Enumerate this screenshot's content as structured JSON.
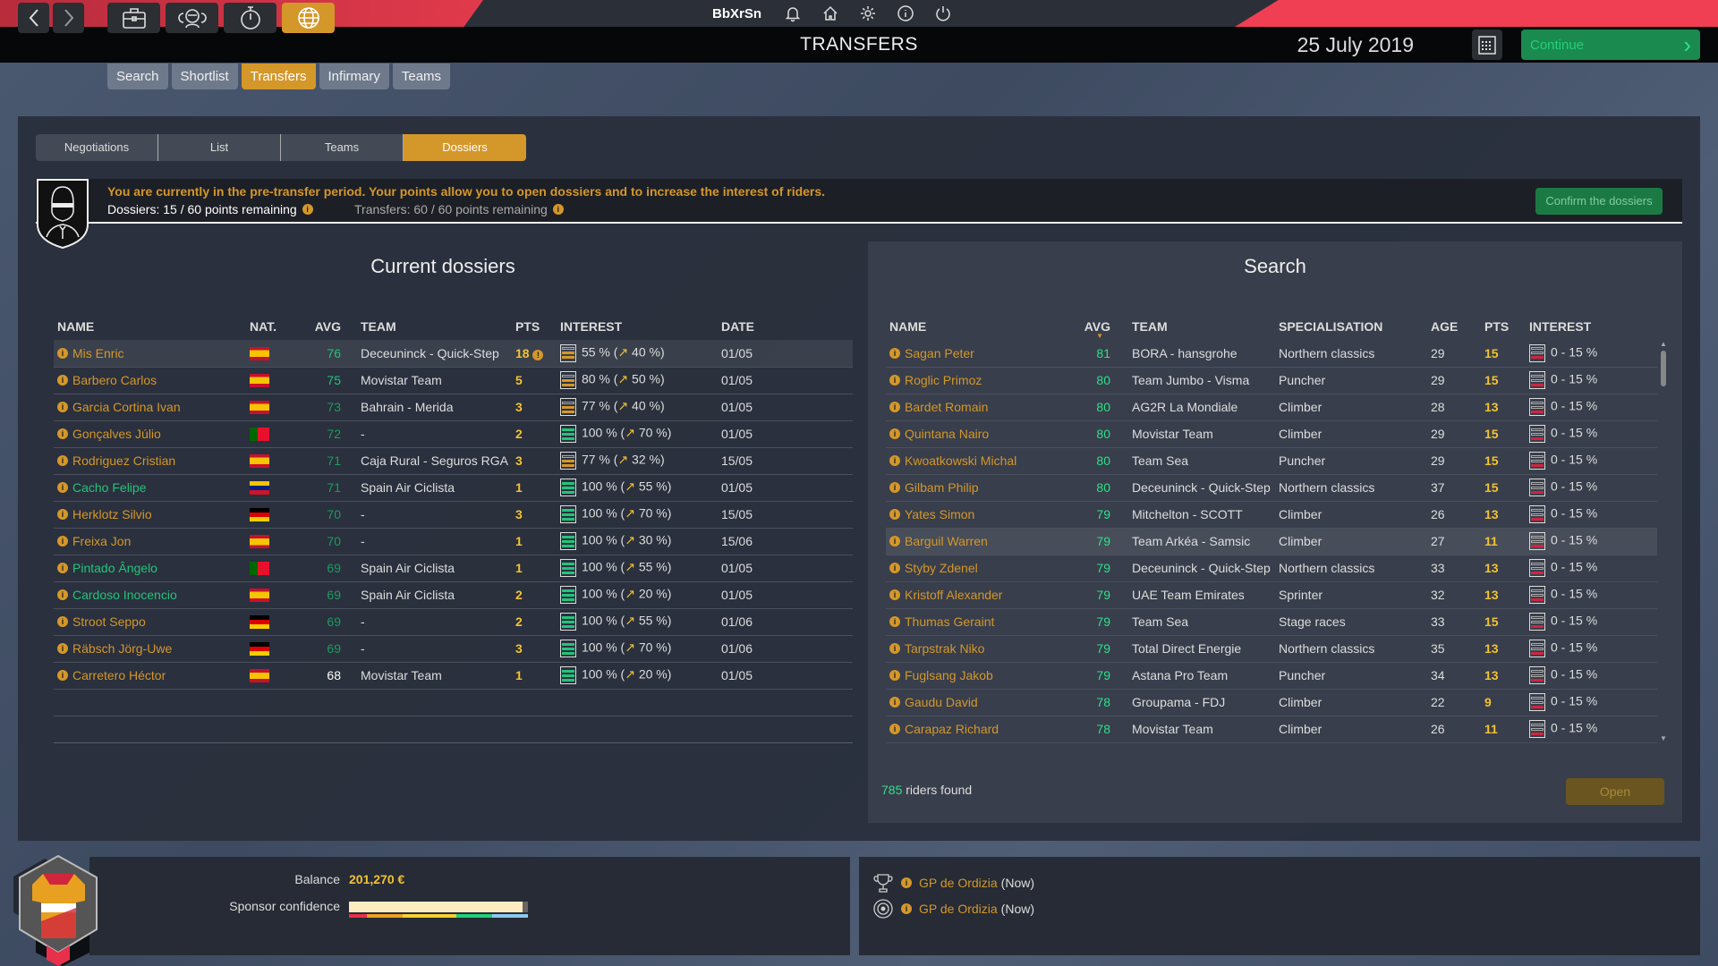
{
  "topbar": {
    "username": "BbXrSn",
    "icons": [
      "bell-icon",
      "home-icon",
      "gear-icon",
      "info-icon",
      "power-icon"
    ]
  },
  "nav": {
    "back_icon": "chevron-left-icon",
    "forward_icon": "chevron-right-icon",
    "sections": [
      {
        "icon": "briefcase-icon",
        "active": false
      },
      {
        "icon": "riders-icon",
        "active": false
      },
      {
        "icon": "stopwatch-icon",
        "active": false
      },
      {
        "icon": "globe-icon",
        "active": true
      }
    ],
    "page_title": "TRANSFERS",
    "date": "25 July 2019",
    "continue_label": "Continue"
  },
  "subtabs": [
    {
      "label": "Search",
      "active": false
    },
    {
      "label": "Shortlist",
      "active": false
    },
    {
      "label": "Transfers",
      "active": true
    },
    {
      "label": "Infirmary",
      "active": false
    },
    {
      "label": "Teams",
      "active": false
    }
  ],
  "tabs": [
    {
      "label": "Negotiations",
      "active": false
    },
    {
      "label": "List",
      "active": false
    },
    {
      "label": "Teams",
      "active": false
    },
    {
      "label": "Dossiers",
      "active": true
    }
  ],
  "info": {
    "message": "You are currently in the pre-transfer period. Your points allow you to open dossiers and to increase the interest of riders.",
    "dossiers_points": "Dossiers: 15 / 60 points remaining",
    "transfers_points": "Transfers: 60 / 60 points remaining",
    "confirm_label": "Confirm the dossiers"
  },
  "current_dossiers": {
    "title": "Current dossiers",
    "columns": [
      "NAME",
      "NAT.",
      "AVG",
      "TEAM",
      "PTS",
      "INTEREST",
      "DATE"
    ],
    "rows": [
      {
        "name": "Mis Enric",
        "nat": "es",
        "avg": "76",
        "avg_style": "g",
        "team": "Deceuninck - Quick-Step",
        "pts": "18",
        "pts_warn": true,
        "gauge": "o",
        "interest": "55 % (",
        "increase": "40 %)",
        "date": "01/05",
        "name_color": "orange",
        "highlight": true
      },
      {
        "name": "Barbero Carlos",
        "nat": "es",
        "avg": "75",
        "avg_style": "g",
        "team": "Movistar Team",
        "pts": "5",
        "gauge": "o",
        "interest": "80 % (",
        "increase": "50 %)",
        "date": "01/05",
        "name_color": "orange"
      },
      {
        "name": "Garcia Cortina Ivan",
        "nat": "es",
        "avg": "73",
        "avg_style": "dg",
        "team": "Bahrain - Merida",
        "pts": "3",
        "gauge": "o",
        "interest": "77 % (",
        "increase": "40 %)",
        "date": "01/05",
        "name_color": "orange"
      },
      {
        "name": "Gonçalves Júlio",
        "nat": "pt",
        "avg": "72",
        "avg_style": "dg",
        "team": "-",
        "pts": "2",
        "gauge": "g",
        "interest": "100 % (",
        "increase": "70 %)",
        "date": "01/05",
        "name_color": "orange"
      },
      {
        "name": "Rodriguez Cristian",
        "nat": "es",
        "avg": "71",
        "avg_style": "dg",
        "team": "Caja Rural - Seguros RGA",
        "pts": "3",
        "gauge": "o",
        "interest": "77 % (",
        "increase": "32 %)",
        "date": "15/05",
        "name_color": "orange"
      },
      {
        "name": "Cacho Felipe",
        "nat": "ve",
        "avg": "71",
        "avg_style": "dg",
        "team": "Spain Air Ciclista",
        "pts": "1",
        "gauge": "g",
        "interest": "100 % (",
        "increase": "55 %)",
        "date": "01/05",
        "name_color": "green"
      },
      {
        "name": "Herklotz Silvio",
        "nat": "de",
        "avg": "70",
        "avg_style": "dg",
        "team": "-",
        "pts": "3",
        "gauge": "g",
        "interest": "100 % (",
        "increase": "70 %)",
        "date": "15/05",
        "name_color": "orange"
      },
      {
        "name": "Freixa Jon",
        "nat": "es",
        "avg": "70",
        "avg_style": "dg",
        "team": "-",
        "pts": "1",
        "gauge": "g",
        "interest": "100 % (",
        "increase": "30 %)",
        "date": "15/06",
        "name_color": "orange"
      },
      {
        "name": "Pintado Ângelo",
        "nat": "pt",
        "avg": "69",
        "avg_style": "dg",
        "team": "Spain Air Ciclista",
        "pts": "1",
        "gauge": "g",
        "interest": "100 % (",
        "increase": "55 %)",
        "date": "01/05",
        "name_color": "green"
      },
      {
        "name": "Cardoso Inocencio",
        "nat": "es",
        "avg": "69",
        "avg_style": "dg",
        "team": "Spain Air Ciclista",
        "pts": "2",
        "gauge": "g",
        "interest": "100 % (",
        "increase": "20 %)",
        "date": "01/05",
        "name_color": "green"
      },
      {
        "name": "Stroot Seppo",
        "nat": "de",
        "avg": "69",
        "avg_style": "dg",
        "team": "-",
        "pts": "2",
        "gauge": "g",
        "interest": "100 % (",
        "increase": "55 %)",
        "date": "01/06",
        "name_color": "orange"
      },
      {
        "name": "Räbsch Jörg-Uwe",
        "nat": "de",
        "avg": "69",
        "avg_style": "dg",
        "team": "-",
        "pts": "3",
        "gauge": "g",
        "interest": "100 % (",
        "increase": "70 %)",
        "date": "01/06",
        "name_color": "orange"
      },
      {
        "name": "Carretero Héctor",
        "nat": "es",
        "avg": "68",
        "avg_style": "w",
        "team": "Movistar Team",
        "pts": "1",
        "gauge": "g",
        "interest": "100 % (",
        "increase": "20 %)",
        "date": "01/05",
        "name_color": "orange"
      }
    ]
  },
  "search": {
    "title": "Search",
    "columns": [
      "NAME",
      "AVG",
      "TEAM",
      "SPECIALISATION",
      "AGE",
      "PTS",
      "INTEREST"
    ],
    "sort_column": "AVG",
    "rows": [
      {
        "name": "Sagan Peter",
        "avg": "81",
        "team": "BORA - hansgrohe",
        "spec": "Northern classics",
        "age": "29",
        "pts": "15",
        "interest": "0 - 15 %"
      },
      {
        "name": "Roglic Primoz",
        "avg": "80",
        "team": "Team Jumbo - Visma",
        "spec": "Puncher",
        "age": "29",
        "pts": "15",
        "interest": "0 - 15 %"
      },
      {
        "name": "Bardet Romain",
        "avg": "80",
        "team": "AG2R La Mondiale",
        "spec": "Climber",
        "age": "28",
        "pts": "13",
        "interest": "0 - 15 %"
      },
      {
        "name": "Quintana Nairo",
        "avg": "80",
        "team": "Movistar Team",
        "spec": "Climber",
        "age": "29",
        "pts": "15",
        "interest": "0 - 15 %"
      },
      {
        "name": "Kwoatkowski Michal",
        "avg": "80",
        "team": "Team Sea",
        "spec": "Puncher",
        "age": "29",
        "pts": "15",
        "interest": "0 - 15 %"
      },
      {
        "name": "Gilbam Philip",
        "avg": "80",
        "team": "Deceuninck - Quick-Step",
        "spec": "Northern classics",
        "age": "37",
        "pts": "15",
        "interest": "0 - 15 %"
      },
      {
        "name": "Yates Simon",
        "avg": "79",
        "team": "Mitchelton - SCOTT",
        "spec": "Climber",
        "age": "26",
        "pts": "13",
        "interest": "0 - 15 %"
      },
      {
        "name": "Barguil Warren",
        "avg": "79",
        "team": "Team Arkéa - Samsic",
        "spec": "Climber",
        "age": "27",
        "pts": "11",
        "interest": "0 - 15 %",
        "highlight": true
      },
      {
        "name": "Styby Zdenel",
        "avg": "79",
        "team": "Deceuninck - Quick-Step",
        "spec": "Northern classics",
        "age": "33",
        "pts": "13",
        "interest": "0 - 15 %"
      },
      {
        "name": "Kristoff Alexander",
        "avg": "79",
        "team": "UAE Team Emirates",
        "spec": "Sprinter",
        "age": "32",
        "pts": "13",
        "interest": "0 - 15 %"
      },
      {
        "name": "Thumas Geraint",
        "avg": "79",
        "team": "Team Sea",
        "spec": "Stage races",
        "age": "33",
        "pts": "15",
        "interest": "0 - 15 %"
      },
      {
        "name": "Tarpstrak Niko",
        "avg": "79",
        "team": "Total Direct Energie",
        "spec": "Northern classics",
        "age": "35",
        "pts": "13",
        "interest": "0 - 15 %"
      },
      {
        "name": "Fuglsang Jakob",
        "avg": "79",
        "team": "Astana Pro Team",
        "spec": "Puncher",
        "age": "34",
        "pts": "13",
        "interest": "0 - 15 %"
      },
      {
        "name": "Gaudu David",
        "avg": "78",
        "team": "Groupama - FDJ",
        "spec": "Climber",
        "age": "22",
        "pts": "9",
        "interest": "0 - 15 %"
      },
      {
        "name": "Carapaz Richard",
        "avg": "78",
        "team": "Movistar Team",
        "spec": "Climber",
        "age": "26",
        "pts": "11",
        "interest": "0 - 15 %"
      }
    ],
    "found_count": "785",
    "found_label": "riders found",
    "open_label": "Open"
  },
  "footer": {
    "balance_label": "Balance",
    "balance_value": "201,270 €",
    "sponsor_label": "Sponsor confidence",
    "sponsor_confidence": 0.97,
    "sponsor_scale_colors": [
      "#e8304a",
      "#f0a020",
      "#f8d030",
      "#23d07a",
      "#8cc8f0"
    ],
    "events": [
      {
        "icon": "trophy-icon",
        "name": "GP de Ordizia",
        "when": "(Now)"
      },
      {
        "icon": "target-icon",
        "name": "GP de Ordizia",
        "when": "(Now)"
      }
    ]
  }
}
